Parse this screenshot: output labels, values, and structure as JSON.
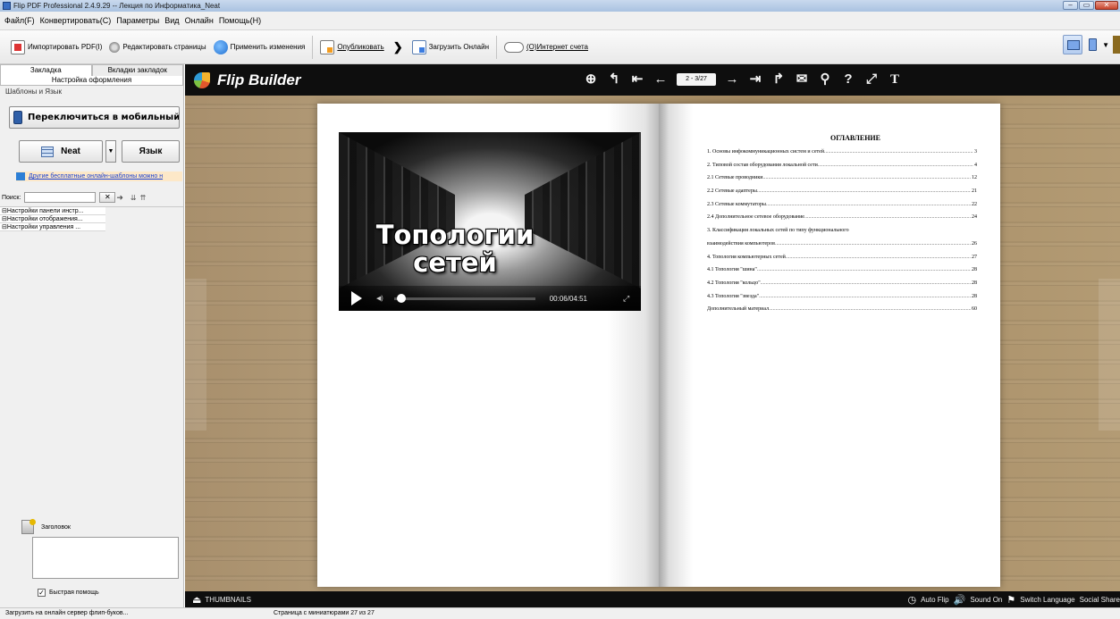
{
  "window": {
    "title": "Flip PDF Professional 2.4.9.29 -- Лекция по Информатика_Neat",
    "controls": [
      "‒",
      "▭",
      "✕"
    ]
  },
  "menu": [
    "Файл(F)",
    "Конвертировать(C)",
    "Параметры",
    "Вид",
    "Онлайн",
    "Помощь(H)"
  ],
  "toolbar": {
    "import": "Импортировать PDF(I)",
    "edit_pages": "Редактировать страницы",
    "apply": "Применить изменения",
    "publish": "Опубликовать",
    "upload": "Загрузить Онлайн",
    "account": "(O)Интернет счета"
  },
  "left_panel": {
    "tabs": [
      "Закладка",
      "Вкладки закладок"
    ],
    "panel_title": "Настройка оформления",
    "section": "Шаблоны и Язык",
    "mobile_button": "Переключиться в мобильный режим",
    "template_button": "Neat",
    "language_button": "Язык",
    "templates_link": "Другие бесплатные онлайн-шаблоны можно н",
    "search_label": "Поиск:",
    "search_value": "",
    "tree": [
      "⊟Настройки панели инстр...",
      "⊟Настройки отображения...",
      "⊟Настройки управления ..."
    ],
    "header_label": "Заголовок",
    "header_text": "",
    "quick_help": "Быстрая помощь",
    "quick_help_checked": true
  },
  "viewer": {
    "brand": "Flip Builder",
    "page_indicator": "2 - 3/27",
    "video": {
      "title_line1": "Топологии",
      "title_line2": "сетей",
      "time": "00:06/04:51",
      "progress": 0.02
    },
    "toc": {
      "heading": "ОГЛАВЛЕНИЕ",
      "entries": [
        {
          "title": "1.  Основы инфокоммуникационных систем и сетей",
          "page": "3"
        },
        {
          "title": "2.  Типовой состав оборудования локальной сети",
          "page": "4"
        },
        {
          "title": "2.1 Сетевые проводники",
          "page": "12"
        },
        {
          "title": "2.2 Сетевые адаптеры",
          "page": "21"
        },
        {
          "title": "2.3  Сетевые коммутаторы",
          "page": "22"
        },
        {
          "title": "2.4 Дополнительное сетевое оборудование",
          "page": "24"
        },
        {
          "title": "3.  Классификация локальных сетей по типу функционального",
          "page": ""
        },
        {
          "title": "взаимодействия компьютеров",
          "page": "26"
        },
        {
          "title": "4.  Топология компьютерных сетей",
          "page": "27"
        },
        {
          "title": "4.1 Топология \"шина\"",
          "page": "28"
        },
        {
          "title": "4.2 Топология \"кольцо\"",
          "page": "28"
        },
        {
          "title": "4.3 Топология \"звезда\"",
          "page": "28"
        },
        {
          "title": "Дополнительный материал",
          "page": "60"
        }
      ]
    },
    "bottom": {
      "thumbnails": "THUMBNAILS",
      "auto_flip": "Auto Flip",
      "sound": "Sound On",
      "switch_language": "Switch Language",
      "social_share": "Social Share"
    }
  },
  "status": {
    "left": "Загрузить на онлайн сервер флип-буков...",
    "middle": "Страница с миниатюрами 27 из 27"
  },
  "colors": {
    "viewer_bar": "#0e0e0e",
    "link": "#1a3fcf",
    "wood": "#b09a74"
  }
}
